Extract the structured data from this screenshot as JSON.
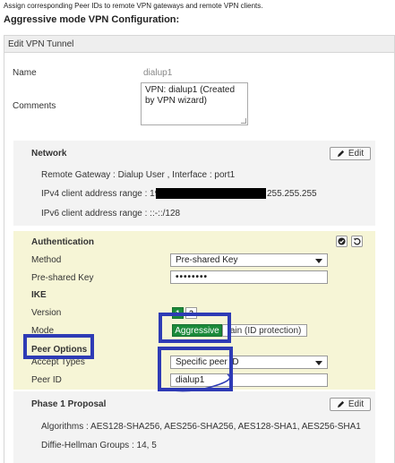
{
  "page": {
    "topnote": "Assign corresponding Peer IDs to remote VPN gateways and remote VPN clients.",
    "heading": "Aggressive mode VPN Configuration:",
    "panel_title": "Edit VPN Tunnel"
  },
  "general": {
    "name_label": "Name",
    "name_value": "dialup1",
    "comments_label": "Comments",
    "comments_value": "VPN: dialup1 (Created by VPN wizard)"
  },
  "network": {
    "title": "Network",
    "edit_label": "Edit",
    "remote_gateway": "Remote Gateway : Dialup User , Interface : port1",
    "ipv4_prefix": "IPv4 client address range : 192.",
    "ipv4_suffix": "255.255.255",
    "ipv6": "IPv6 client address range : ::-::/128"
  },
  "authentication": {
    "title": "Authentication",
    "method_label": "Method",
    "method_value": "Pre-shared Key",
    "psk_label": "Pre-shared Key",
    "psk_value": "••••••••",
    "ike_label": "IKE",
    "version_label": "Version",
    "version_options": [
      "1",
      "2"
    ],
    "mode_label": "Mode",
    "mode_aggressive": "Aggressive",
    "mode_main": "Main (ID protection)",
    "mode_main_visible": "lain (ID protection)",
    "peer_options_label": "Peer Options",
    "accept_types_label": "Accept Types",
    "accept_types_value": "Specific peer ID",
    "peer_id_label": "Peer ID",
    "peer_id_value": "dialup1"
  },
  "phase1": {
    "title": "Phase 1 Proposal",
    "edit_label": "Edit",
    "algorithms": "Algorithms : AES128-SHA256, AES256-SHA256, AES128-SHA1, AES256-SHA1",
    "dh_groups": "Diffie-Hellman Groups : 14, 5"
  },
  "colors": {
    "auth_bg": "#f6f5d6",
    "section_bg": "#f3f3f3",
    "accent_green": "#1b8a3a",
    "annotation_blue": "#2e3bb5"
  }
}
